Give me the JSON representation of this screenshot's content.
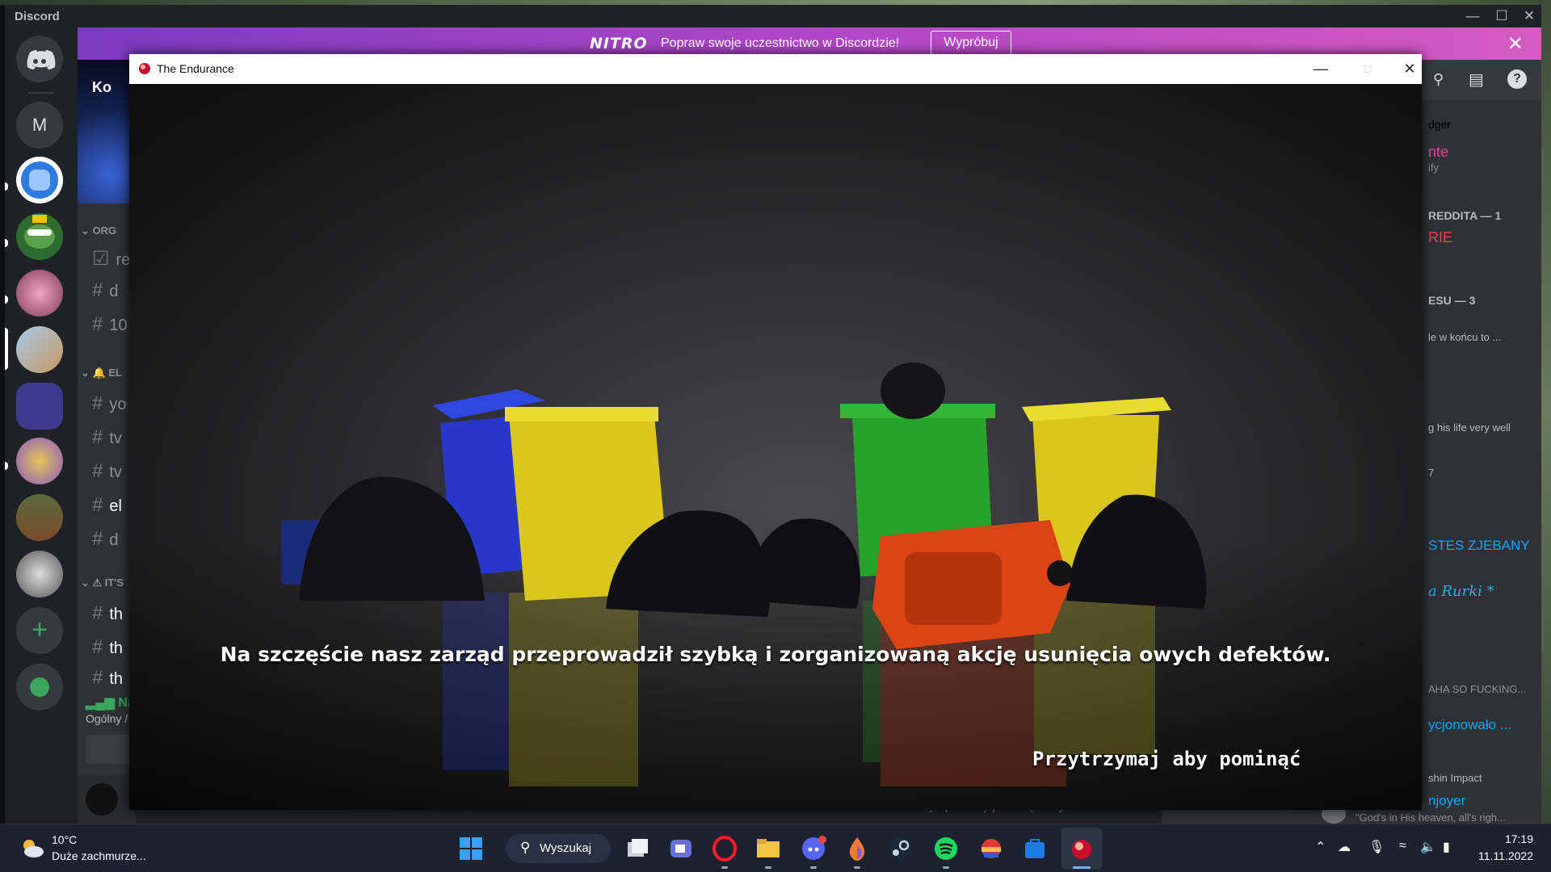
{
  "discord": {
    "app_title": "Discord",
    "nitro": {
      "logo": "NITRO",
      "message": "Popraw swoje uczestnictwo w Discordzie!",
      "button": "Wypróbuj"
    },
    "rail": {
      "dm_initial": "M"
    },
    "channels": {
      "server_name": "Ko",
      "categories": [
        "ORG",
        "EL",
        "IT'S"
      ],
      "rows": [
        "re",
        "d",
        "10",
        "yo",
        "tv",
        "tv",
        "el",
        "d",
        "th",
        "th",
        "th"
      ],
      "voice_channel": "Naw",
      "voice_sub": "Ogólny /"
    },
    "right_panel": {
      "items": [
        {
          "text": "dger",
          "color": "#b9bbbe"
        },
        {
          "text": "nte",
          "color": "#eb459e"
        },
        {
          "text": "ify",
          "color": "#8e9297"
        },
        {
          "text": "REDDITA — 1",
          "color": "#b9bbbe"
        },
        {
          "text": "RIE",
          "color": "#f04747"
        },
        {
          "text": "ESU — 3",
          "color": "#b9bbbe"
        },
        {
          "text": "le w końcu to ...",
          "color": "#b9bbbe"
        },
        {
          "text": "g his life very well",
          "color": "#b9bbbe"
        },
        {
          "text": "7",
          "color": "#b9bbbe"
        },
        {
          "text": "STES ZJEBANY",
          "color": "#00a8fc"
        },
        {
          "text": "a Rurki *",
          "color": "#1fb3e8"
        },
        {
          "text": "AHA SO FUCKING...",
          "color": "#8e9297"
        },
        {
          "text": "ycjonowało ...",
          "color": "#00a8fc"
        },
        {
          "text": "shin Impact",
          "color": "#b9bbbe"
        },
        {
          "text": "njoyer",
          "color": "#00a8fc"
        },
        {
          "text": "\"God's in His heaven, all's righ...",
          "color": "#8e9297"
        }
      ]
    },
    "chat_status": "Tryb powolny jest włączony."
  },
  "game": {
    "window_title": "The Endurance",
    "subtitle": "Na szczęście nasz zarząd przeprowadził szybką i zorganizowaną akcję usunięcia owych defektów.",
    "skip_hint": "Przytrzymaj aby pominąć"
  },
  "taskbar": {
    "weather_temp": "10°C",
    "weather_condition": "Duże zachmurze...",
    "search_label": "Wyszukaj",
    "time": "17:19",
    "date": "11.11.2022",
    "apps": [
      "start-icon",
      "search",
      "task-view-icon",
      "teams-chat-icon",
      "opera-icon",
      "file-explorer-icon",
      "discord-icon",
      "paint-drop-icon",
      "steam-icon",
      "spotify-icon",
      "game-launcher-icon",
      "store-icon",
      "endurance-game-icon"
    ]
  }
}
